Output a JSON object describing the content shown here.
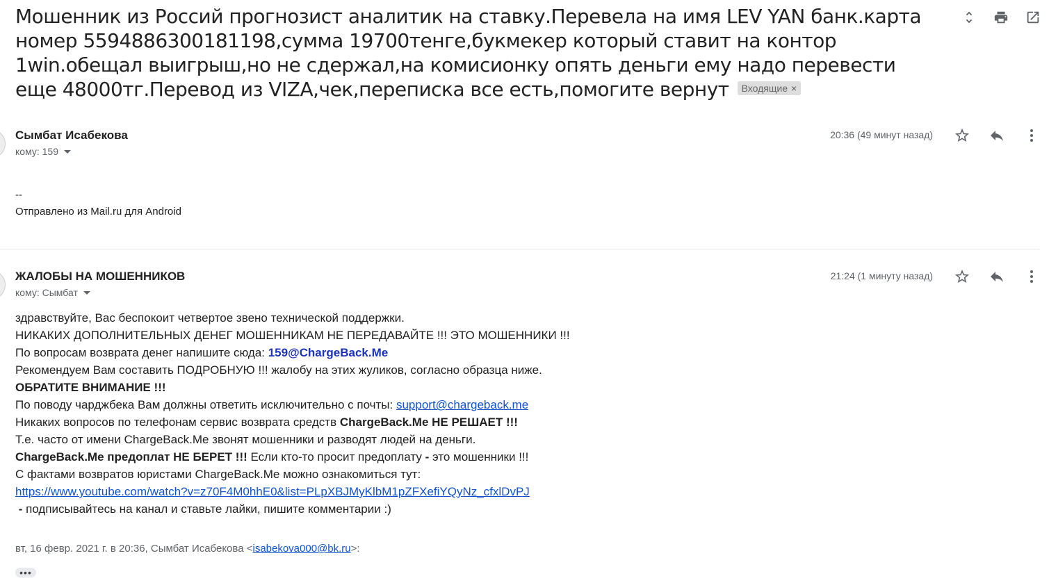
{
  "subject": {
    "text": "Мошенник из Россий прогнозист аналитик на ставку.Перевела на имя LEV YAN банк.карта номер 5594886300181198,сумма 19700тенге,букмекер который ставит на контор 1win.обещал выигрыш,но не сдержал,на комисионку опять деньги ему надо перевести еще 48000тг.Перевод из VIZA,чек,переписка все есть,помогите вернут",
    "label": "Входящие",
    "label_close": "×"
  },
  "toolbar_icons": [
    "expand-collapse-icon",
    "print-icon",
    "open-new-window-icon"
  ],
  "messages": [
    {
      "sender": "Сымбат Исабекова",
      "to": "кому: 159",
      "time": "20:36 (49 минут назад)",
      "body": [
        "--",
        "Отправлено из Mail.ru для Android"
      ]
    },
    {
      "sender": "ЖАЛОБЫ НА МОШЕННИКОВ",
      "to": "кому: Сымбат",
      "time": "21:24 (1 минуту назад)",
      "body": {
        "l1": "здравствуйте, Вас беспокоит четвертое звено технической поддержки.",
        "l2": "НИКАКИХ ДОПОЛНИТЕЛЬНЫХ ДЕНЕГ МОШЕННИКАМ НЕ ПЕРЕДАВАЙТЕ !!! ЭТО МОШЕННИКИ !!!",
        "l3_text": "По вопросам возврата денег напишите сюда: ",
        "l3_email": "159@ChargeBack.Me",
        "l4": "Рекомендуем Вам составить ПОДРОБНУЮ !!! жалобу на этих жуликов, согласно образца ниже.",
        "l5": "ОБРАТИТЕ ВНИМАНИЕ !!!",
        "l6_text": "По поводу чарджбека Вам должны ответить исключительно с почты: ",
        "l6_link": "support@chargeback.me",
        "l7_text": "Никаких вопросов по телефонам сервис возврата средств ",
        "l7_bold": "ChargeBack.Me НЕ РЕШАЕТ !!!",
        "l8": "Т.е. часто от имени ChargeBack.Me звонят мошенники и разводят людей на деньги.",
        "l9_bold": "ChargeBack.Me предоплат НЕ БЕРЕТ !!!",
        "l9_text": " Если кто-то просит предоплату ",
        "l9_dash": "-",
        "l9_text2": " это мошенники !!!",
        "l10": "С фактами возвратов юристами ChargeBack.Me можно ознакомиться тут:",
        "l11_link": "https://www.youtube.com/watch?v=z70F4M0hhE0&list=PLpXBJMyKlbM1pZFXefiYQyNz_cfxlDvPJ",
        "l12_dash": "-",
        "l12_text": " подписывайтесь на канал и ставьте лайки, пишите комментарии :)"
      },
      "quote": {
        "prefix": "вт, 16 февр. 2021 г. в 20:36, Сымбат Исабекова <",
        "email": "isabekova000@bk.ru",
        "suffix": ">:"
      },
      "show_trimmed": "•••"
    }
  ],
  "message_action_icons": [
    "star-icon",
    "reply-icon",
    "more-vert-icon"
  ]
}
